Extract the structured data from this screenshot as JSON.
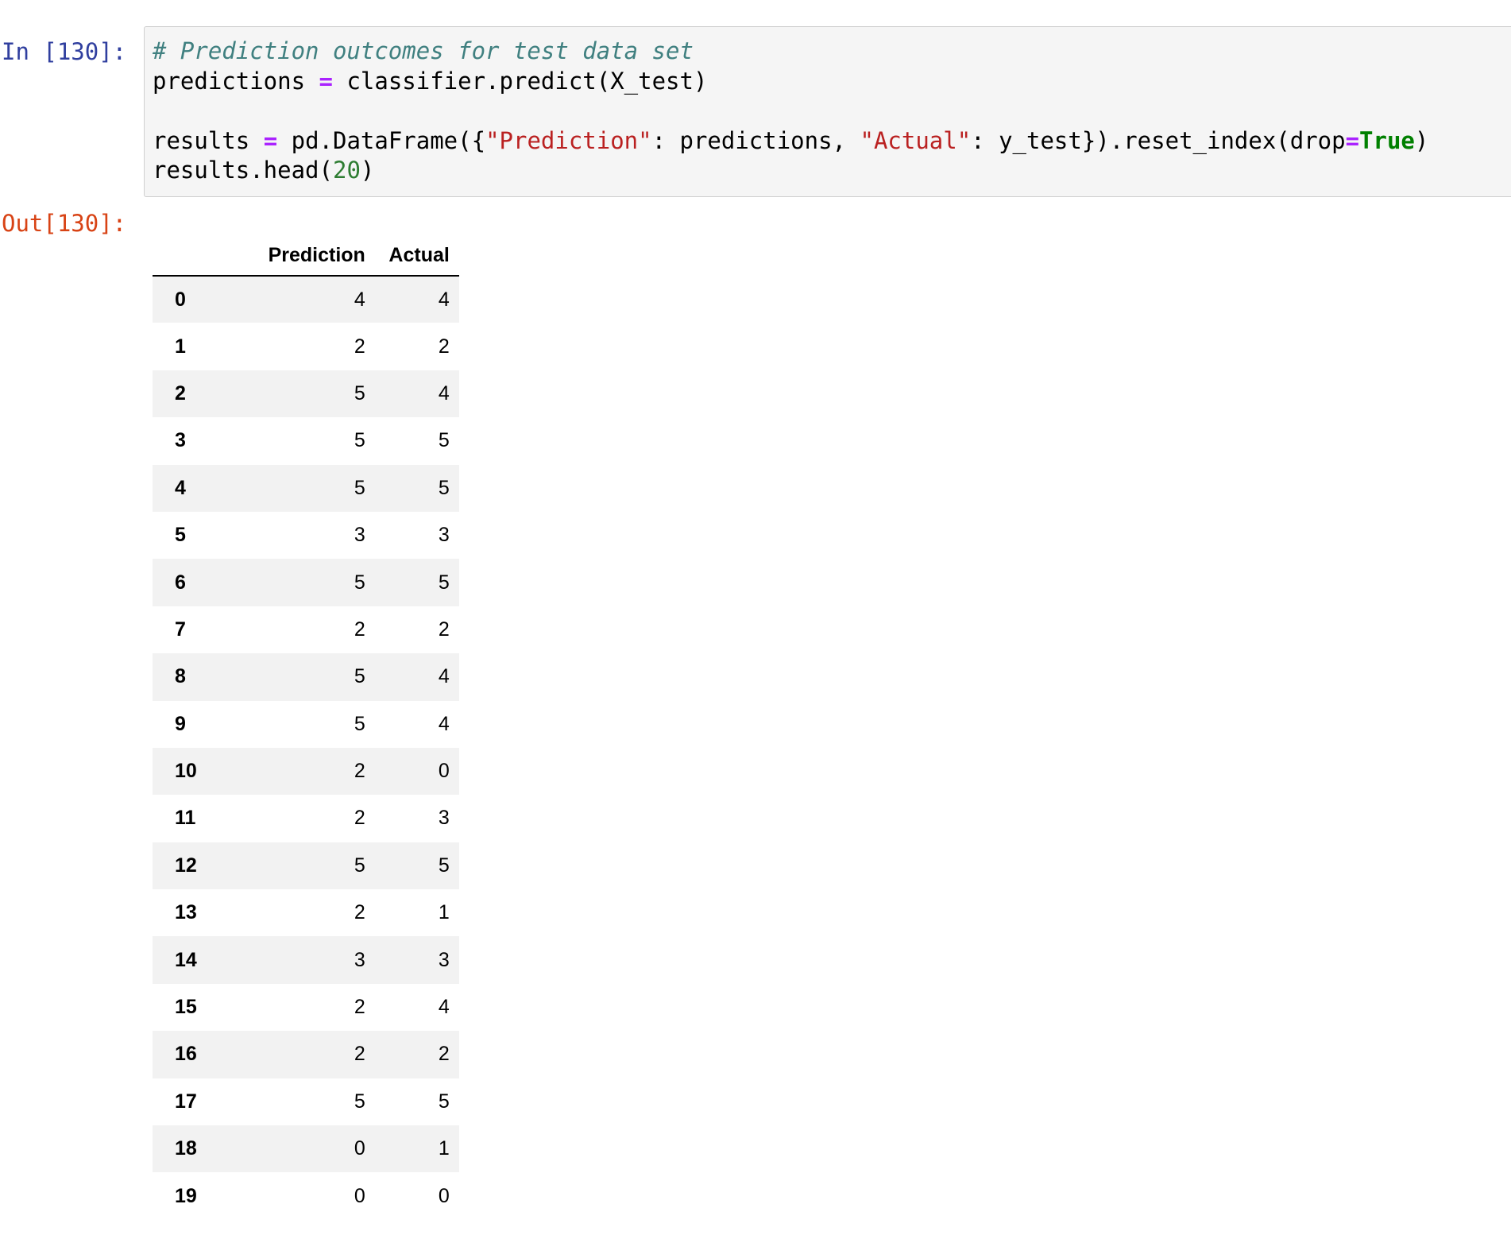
{
  "cell": {
    "in_prompt": "In [130]:",
    "out_prompt": "Out[130]:",
    "code": {
      "comment": "# Prediction outcomes for test data set",
      "l2_a": "predictions",
      "l2_op": "=",
      "l2_b": "classifier.predict(X_test)",
      "l4_a": "results",
      "l4_op": "=",
      "l4_b": "pd.DataFrame({",
      "l4_str1": "\"Prediction\"",
      "l4_c": ": predictions, ",
      "l4_str2": "\"Actual\"",
      "l4_d": ": y_test}).reset_index(drop",
      "l4_op2": "=",
      "l4_kw": "True",
      "l4_e": ")",
      "l5_a": "results.head(",
      "l5_num": "20",
      "l5_b": ")"
    }
  },
  "table": {
    "columns": [
      "Prediction",
      "Actual"
    ],
    "rows": [
      {
        "index": "0",
        "prediction": "4",
        "actual": "4"
      },
      {
        "index": "1",
        "prediction": "2",
        "actual": "2"
      },
      {
        "index": "2",
        "prediction": "5",
        "actual": "4"
      },
      {
        "index": "3",
        "prediction": "5",
        "actual": "5"
      },
      {
        "index": "4",
        "prediction": "5",
        "actual": "5"
      },
      {
        "index": "5",
        "prediction": "3",
        "actual": "3"
      },
      {
        "index": "6",
        "prediction": "5",
        "actual": "5"
      },
      {
        "index": "7",
        "prediction": "2",
        "actual": "2"
      },
      {
        "index": "8",
        "prediction": "5",
        "actual": "4"
      },
      {
        "index": "9",
        "prediction": "5",
        "actual": "4"
      },
      {
        "index": "10",
        "prediction": "2",
        "actual": "0"
      },
      {
        "index": "11",
        "prediction": "2",
        "actual": "3"
      },
      {
        "index": "12",
        "prediction": "5",
        "actual": "5"
      },
      {
        "index": "13",
        "prediction": "2",
        "actual": "1"
      },
      {
        "index": "14",
        "prediction": "3",
        "actual": "3"
      },
      {
        "index": "15",
        "prediction": "2",
        "actual": "4"
      },
      {
        "index": "16",
        "prediction": "2",
        "actual": "2"
      },
      {
        "index": "17",
        "prediction": "5",
        "actual": "5"
      },
      {
        "index": "18",
        "prediction": "0",
        "actual": "1"
      },
      {
        "index": "19",
        "prediction": "0",
        "actual": "0"
      }
    ]
  }
}
